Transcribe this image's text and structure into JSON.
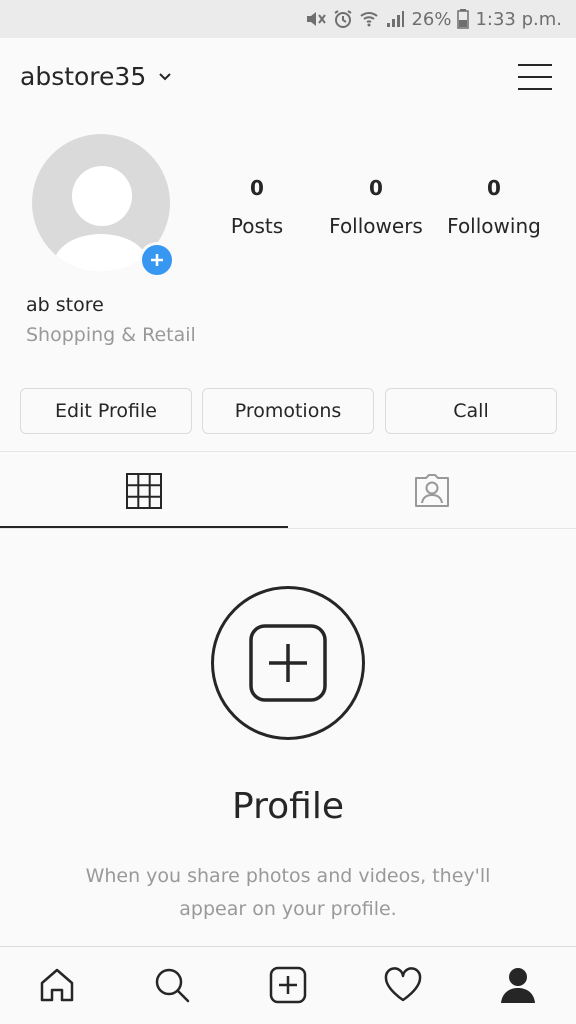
{
  "status_bar": {
    "battery": "26%",
    "time": "1:33 p.m."
  },
  "header": {
    "username": "abstore35"
  },
  "profile": {
    "stats": [
      {
        "value": "0",
        "label": "Posts"
      },
      {
        "value": "0",
        "label": "Followers"
      },
      {
        "value": "0",
        "label": "Following"
      }
    ],
    "display_name": "ab store",
    "category": "Shopping & Retail"
  },
  "actions": {
    "edit_profile": "Edit Profile",
    "promotions": "Promotions",
    "call": "Call"
  },
  "tabs": {
    "active": "grid",
    "items": [
      "grid-icon",
      "tagged-icon"
    ]
  },
  "empty_state": {
    "title": "Profile",
    "message_line1": "When you share photos and videos, they'll",
    "message_line2": "appear on your profile."
  },
  "bottom_nav": {
    "items": [
      "home-icon",
      "search-icon",
      "add-post-icon",
      "activity-heart-icon",
      "profile-icon"
    ],
    "active": "profile-icon"
  },
  "colors": {
    "accent_blue": "#3897f0",
    "text": "#262626",
    "secondary_text": "#999999",
    "border": "#dbdbdb"
  }
}
